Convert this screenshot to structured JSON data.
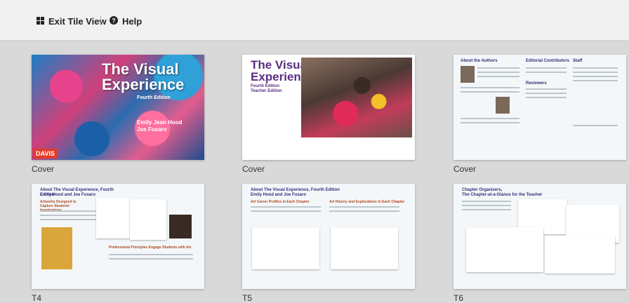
{
  "toolbar": {
    "exit_tile_view": "Exit Tile View",
    "help": "Help",
    "exit_icon": "grid-icon",
    "help_icon": "question-circle-icon"
  },
  "covers": {
    "c1": {
      "title_line1": "The Visual",
      "title_line2": "Experience",
      "edition": "Fourth Edition",
      "author1": "Emily Jean Hood",
      "author2": "Joe Fusaro",
      "logo": "DAVIS"
    },
    "c2": {
      "title_line1": "The Visual",
      "title_line2": "Experience",
      "edition": "Fourth Edition",
      "teacher": "Teacher Edition"
    },
    "c3": {
      "h1": "About the Authors",
      "h2": "Editorial Contributors",
      "h3": "Staff",
      "h4": "Reviewers"
    }
  },
  "t4": {
    "title": "About The Visual Experience, Fourth Edition",
    "authors": "Emily Hood and Joe Fusaro",
    "sub1": "Artworks Designed to Capture Students' Imaginations",
    "sub2": "Professional Principles Engage Students with Art"
  },
  "t5": {
    "title": "About The Visual Experience, Fourth Edition",
    "authors": "Emily Hood and Joe Fusaro",
    "sub1": "Art Career Profiles in Each Chapter",
    "sub2": "Art History and Explorations in Each Chapter"
  },
  "t6": {
    "title": "Chapter Organizers,",
    "title2": "The Chapter-at-a-Glance for the Teacher"
  },
  "captions": [
    "Cover",
    "Cover",
    "Cover",
    "T4",
    "T5",
    "T6"
  ]
}
